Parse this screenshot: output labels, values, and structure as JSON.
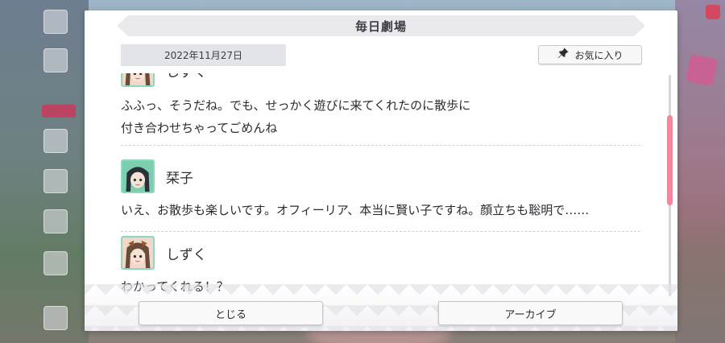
{
  "dialog": {
    "title": "毎日劇場",
    "date": "2022年11月27日",
    "favorite_label": "お気に入り",
    "close_label": "とじる",
    "archive_label": "アーカイブ"
  },
  "entries": [
    {
      "speaker": "しずく",
      "lines": [
        "ふふっ、そうだね。でも、せっかく遊びに来てくれたのに散歩に",
        "付き合わせちゃってごめんね"
      ]
    },
    {
      "speaker": "栞子",
      "lines": [
        "いえ、お散歩も楽しいです。オフィーリア、本当に賢い子ですね。顔立ちも聡明で……"
      ]
    },
    {
      "speaker": "しずく",
      "lines": [
        "わかってくれる！？"
      ]
    }
  ],
  "icons": {
    "favorite": "pin-icon",
    "avatar_shizuku": "shizuku-avatar-icon",
    "avatar_shioriko": "shioriko-avatar-icon"
  },
  "colors": {
    "accent_scrollbar": "#f2889d",
    "avatar_bg": "#7ccfae",
    "title_bar_bg": "#e9e9ee"
  }
}
